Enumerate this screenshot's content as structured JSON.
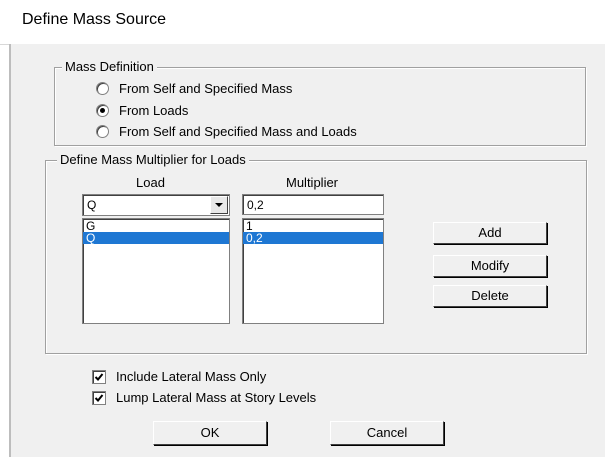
{
  "window": {
    "title": "Define Mass Source"
  },
  "mass_definition": {
    "legend": "Mass Definition",
    "options": [
      {
        "label": "From Self and Specified Mass",
        "selected": false
      },
      {
        "label": "From Loads",
        "selected": true
      },
      {
        "label": "From Self and Specified Mass and Loads",
        "selected": false
      }
    ]
  },
  "multiplier_group": {
    "legend": "Define Mass Multiplier for Loads",
    "load_header": "Load",
    "multiplier_header": "Multiplier",
    "load_combo_value": "Q",
    "multiplier_input_value": "0,2",
    "load_list": [
      {
        "value": "G",
        "selected": false
      },
      {
        "value": "Q",
        "selected": true
      }
    ],
    "multiplier_list": [
      {
        "value": "1",
        "selected": false
      },
      {
        "value": "0,2",
        "selected": true
      }
    ],
    "buttons": {
      "add": "Add",
      "modify": "Modify",
      "delete": "Delete"
    }
  },
  "options": {
    "include_lateral_mass_only": {
      "label": "Include Lateral Mass Only",
      "checked": true
    },
    "lump_lateral_mass": {
      "label": "Lump Lateral Mass at Story Levels",
      "checked": true
    }
  },
  "footer": {
    "ok": "OK",
    "cancel": "Cancel"
  },
  "colors": {
    "selection": "#1e77d3",
    "dialog_bg": "#f0f0f0"
  }
}
